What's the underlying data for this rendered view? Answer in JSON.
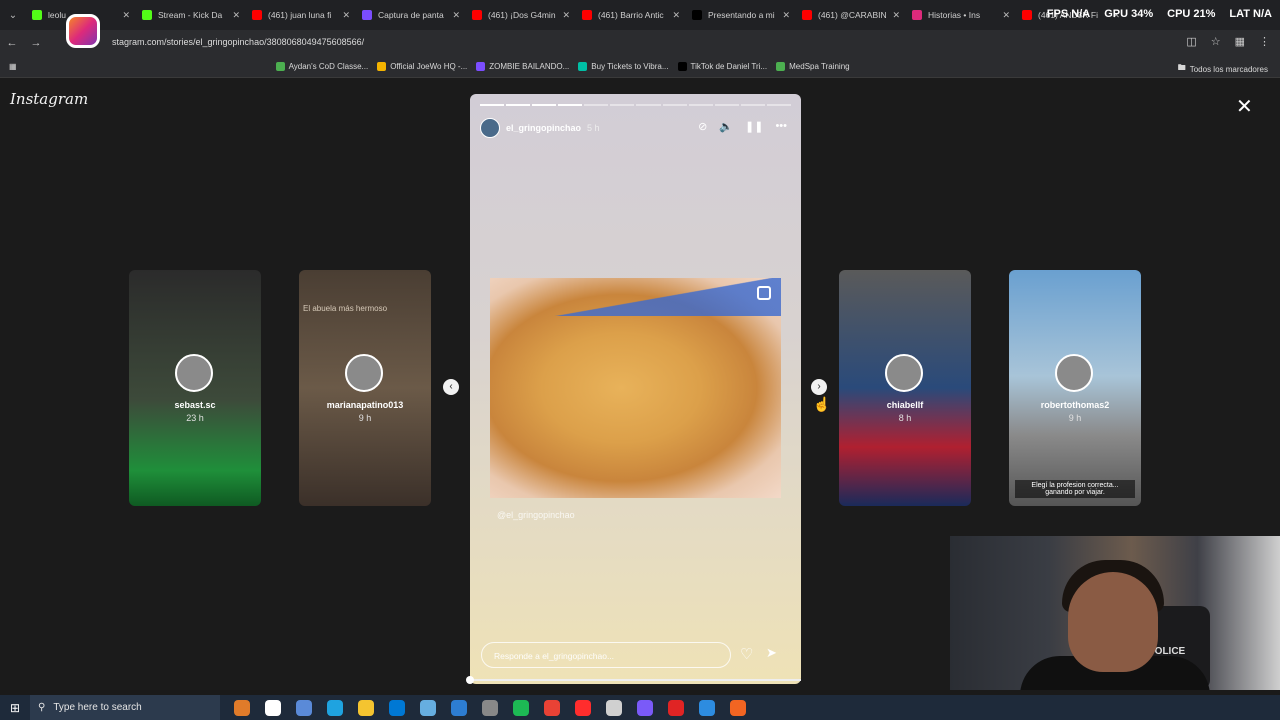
{
  "browser": {
    "tabs": [
      {
        "title": "leolu",
        "color": "#53fc18"
      },
      {
        "title": "Stream - Kick Da",
        "color": "#53fc18"
      },
      {
        "title": "(461) juan luna fi",
        "color": "#ff0000"
      },
      {
        "title": "Captura de panta",
        "color": "#7b4dff"
      },
      {
        "title": "(461) ¡Dos G4min",
        "color": "#ff0000"
      },
      {
        "title": "(461) Barrio Antic",
        "color": "#ff0000"
      },
      {
        "title": "Presentando a mi",
        "color": "#000000"
      },
      {
        "title": "(461) @CARABIN",
        "color": "#ff0000"
      },
      {
        "title": "Historias • Ins",
        "color": "#dd2a7b"
      },
      {
        "title": "(461) AND3R Fi",
        "color": "#ff0000"
      }
    ],
    "url": "stagram.com/stories/el_gringopinchao/3808068049475608566/",
    "bookmarks": [
      {
        "label": "Aydan's CoD Classe...",
        "color": "#4caf50"
      },
      {
        "label": "Official JoeWo HQ -...",
        "color": "#f4b400"
      },
      {
        "label": "ZOMBIE BAILANDO...",
        "color": "#7b4dff"
      },
      {
        "label": "Buy Tickets to Vibra...",
        "color": "#00bfa5"
      },
      {
        "label": "TikTok de Daniel Tri...",
        "color": "#000000"
      },
      {
        "label": "MedSpa Training",
        "color": "#4caf50"
      }
    ],
    "all_bookmarks": "Todos los marcadores"
  },
  "hud": {
    "fps": "FPS N/A",
    "gpu": "GPU 34%",
    "cpu": "CPU 21%",
    "lat": "LAT N/A"
  },
  "instagram": {
    "brand": "Instagram",
    "side_stories": [
      {
        "user": "sebast.sc",
        "time": "23 h",
        "bg": "linear-gradient(to bottom,#2b2b2b 0%,#3d4a3a 55%,#1f8f3a 85%,#0f5a22 100%)",
        "top_text": "",
        "caption": ""
      },
      {
        "user": "marianapatino013",
        "time": "9 h",
        "bg": "linear-gradient(to bottom,#4a3e33 0%,#6b5a48 50%,#3b3029 100%)",
        "top_text": "El abuela más hermoso",
        "caption": ""
      },
      {
        "user": "chiabellf",
        "time": "8 h",
        "bg": "linear-gradient(to bottom,#5a5a5a 0%,#2a4a7a 50%,#b02030 75%,#1a2a5a 100%)",
        "top_text": "",
        "caption": ""
      },
      {
        "user": "robertothomas2",
        "time": "9 h",
        "bg": "linear-gradient(to bottom,#6aa0d0 0%,#a8c4d8 45%,#8a8a8a 70%,#555 100%)",
        "top_text": "",
        "caption": "Elegí la profesion correcta... ganando por viajar."
      }
    ],
    "story": {
      "user": "el_gringopinchao",
      "time": "5 h",
      "segments_total": 12,
      "segments_done": 4,
      "tag": "@el_gringopinchao",
      "reply_placeholder": "Responde a el_gringopinchao..."
    }
  },
  "taskbar": {
    "search_placeholder": "Type here to search",
    "icons": [
      "#e07b2a",
      "#ffffff",
      "#5a8ad8",
      "#1fa3e0",
      "#f4c430",
      "#0078d4",
      "#66aee0",
      "#2d7dd2",
      "#888888",
      "#1db954",
      "#e94235",
      "#ff2d2d",
      "#d0d0d0",
      "#7a5af8",
      "#e02424",
      "#2d8ce0",
      "#f26522"
    ]
  }
}
